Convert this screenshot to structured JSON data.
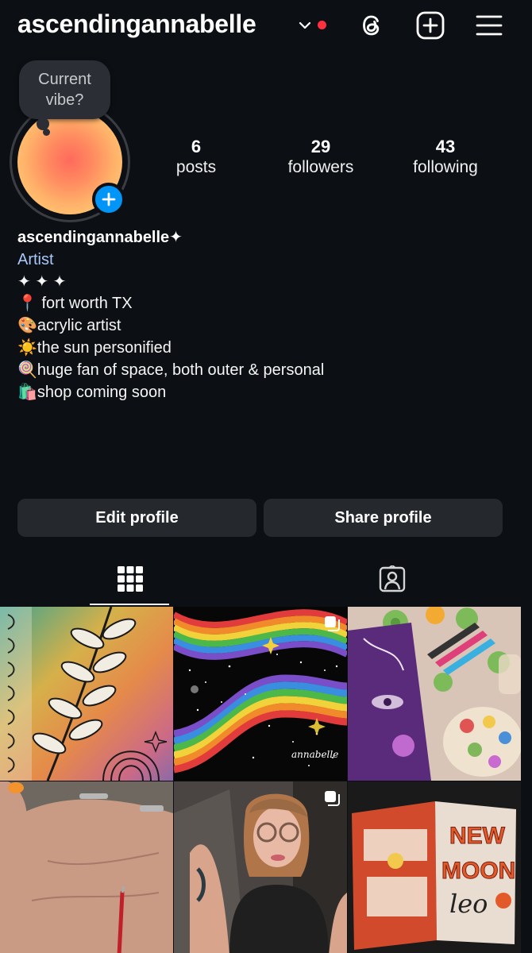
{
  "header": {
    "username": "ascendingannabelle",
    "icons": [
      "chevron-down-icon",
      "threads-icon",
      "create-post-icon",
      "menu-icon"
    ],
    "notification_dot_color": "#ff3040"
  },
  "note_bubble": {
    "line1": "Current",
    "line2": "vibe?"
  },
  "stats": [
    {
      "value": "6",
      "label": "posts"
    },
    {
      "value": "29",
      "label": "followers"
    },
    {
      "value": "43",
      "label": "following"
    }
  ],
  "bio": {
    "name": "ascendingannabelle✦",
    "category": "Artist",
    "lines": [
      "✦ ✦ ✦",
      "📍 fort worth TX",
      "🎨acrylic artist",
      "☀️the sun personified",
      "🍭huge fan of space, both outer & personal",
      "🛍️shop coming soon"
    ]
  },
  "actions": {
    "edit": "Edit profile",
    "share": "Share profile"
  },
  "tabs": [
    {
      "name": "posts-grid",
      "icon": "grid-icon",
      "active": true
    },
    {
      "name": "tagged",
      "icon": "tagged-person-icon",
      "active": false
    }
  ],
  "posts": [
    {
      "subject": "leaf sketch on watercolor notebook",
      "multi": false
    },
    {
      "subject": "rainbow space painting",
      "multi": true
    },
    {
      "subject": "purple art with markers and palette",
      "multi": false
    },
    {
      "subject": "hand holding paintbrush",
      "multi": false
    },
    {
      "subject": "selfie with glasses",
      "multi": true
    },
    {
      "subject": "new moon in leo journal",
      "multi": false
    }
  ],
  "grid_text": {
    "journal_title1": "NEW",
    "journal_title2": "MOON",
    "journal_title3": "leo",
    "signature": "annabelle"
  },
  "colors": {
    "background": "#0c1014",
    "button": "#25292e",
    "accent": "#0095f6",
    "category": "#a8c7fa"
  }
}
